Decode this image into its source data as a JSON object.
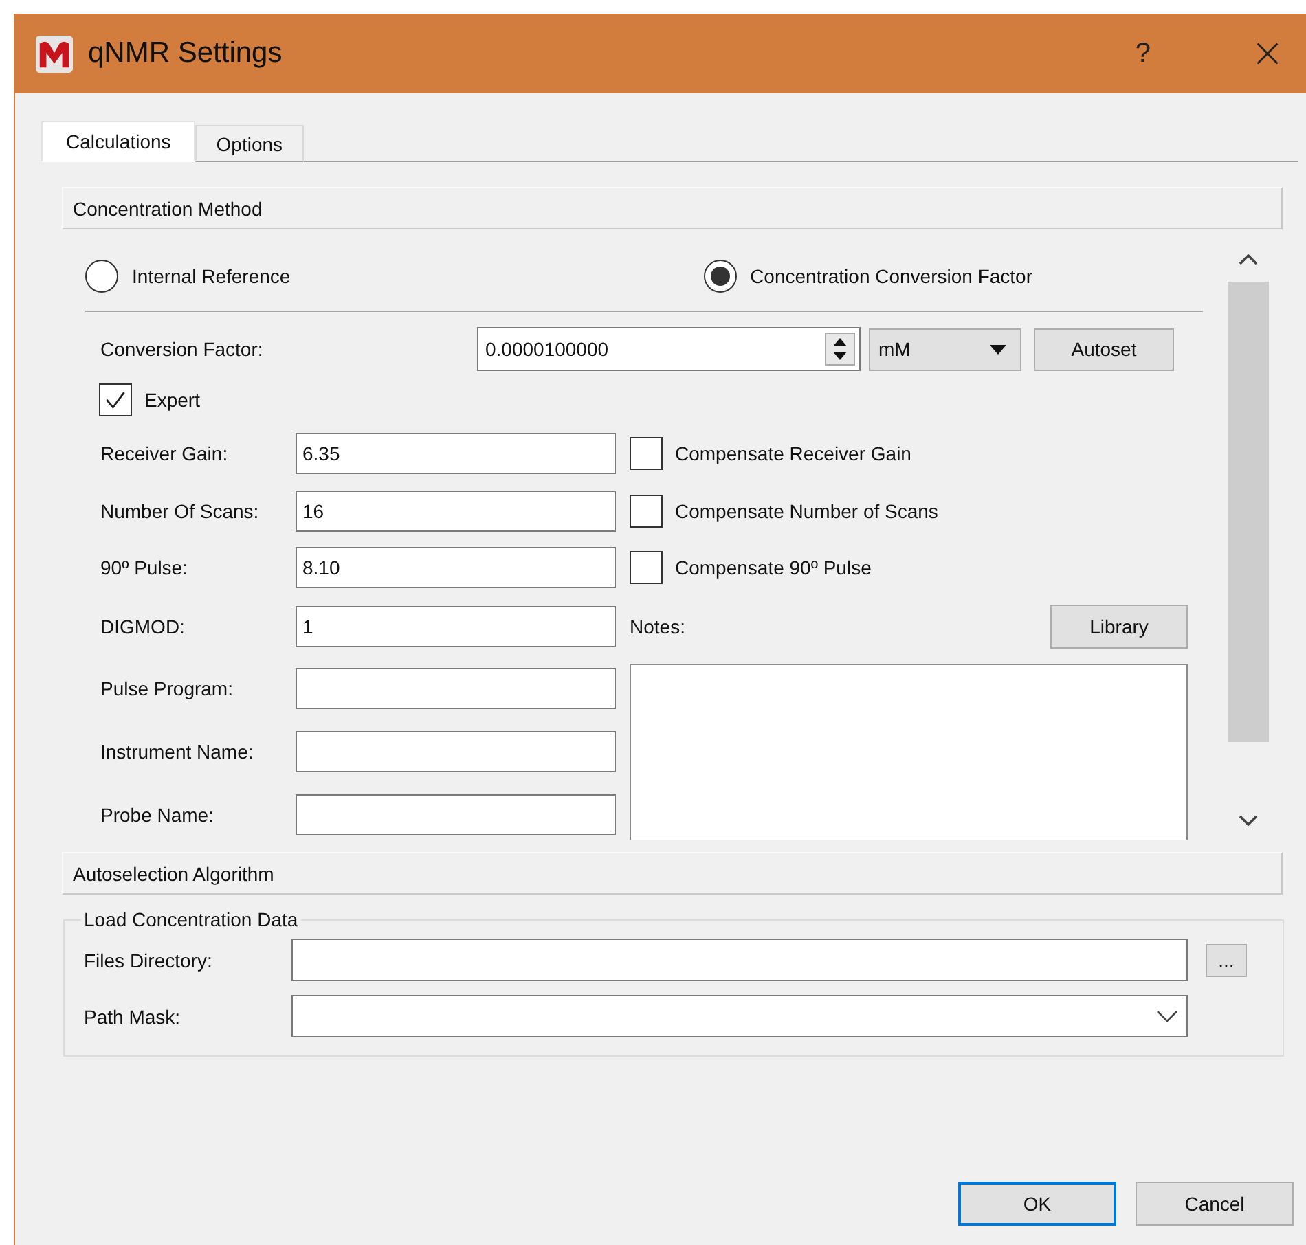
{
  "window": {
    "title": "qNMR Settings",
    "help": "?"
  },
  "tabs": [
    {
      "label": "Calculations",
      "selected": true
    },
    {
      "label": "Options",
      "selected": false
    }
  ],
  "concentration_method": {
    "header": "Concentration Method",
    "methods": [
      {
        "label": "Internal Reference",
        "selected": false
      },
      {
        "label": "Concentration Conversion Factor",
        "selected": true
      }
    ],
    "conversion_factor": {
      "label": "Conversion Factor:",
      "value": "0.0000100000",
      "unit": "mM",
      "button": "Autoset"
    },
    "expert": {
      "label": "Expert",
      "checked": true
    },
    "fields": [
      {
        "label": "Receiver Gain:",
        "value": "6.35"
      },
      {
        "label": "Number Of Scans:",
        "value": "16"
      },
      {
        "label": "90º Pulse:",
        "value": "8.10"
      },
      {
        "label": "DIGMOD:",
        "value": "1"
      },
      {
        "label": "Pulse Program:"
      },
      {
        "label": "Instrument Name:"
      },
      {
        "label": "Probe Name:"
      }
    ],
    "compensations": [
      {
        "label": "Compensate Receiver Gain",
        "checked": false
      },
      {
        "label": "Compensate Number of Scans",
        "checked": false
      },
      {
        "label": "Compensate 90º Pulse",
        "checked": false
      }
    ],
    "notes": {
      "label": "Notes:",
      "button": "Library"
    }
  },
  "autoselection": {
    "header": "Autoselection Algorithm"
  },
  "load_data": {
    "title": "Load Concentration Data",
    "files_directory": {
      "label": "Files Directory:",
      "browse": "..."
    },
    "path_mask": {
      "label": "Path Mask:"
    }
  },
  "buttons": [
    {
      "label": "OK",
      "focused": true
    },
    {
      "label": "Cancel",
      "focused": false
    }
  ]
}
